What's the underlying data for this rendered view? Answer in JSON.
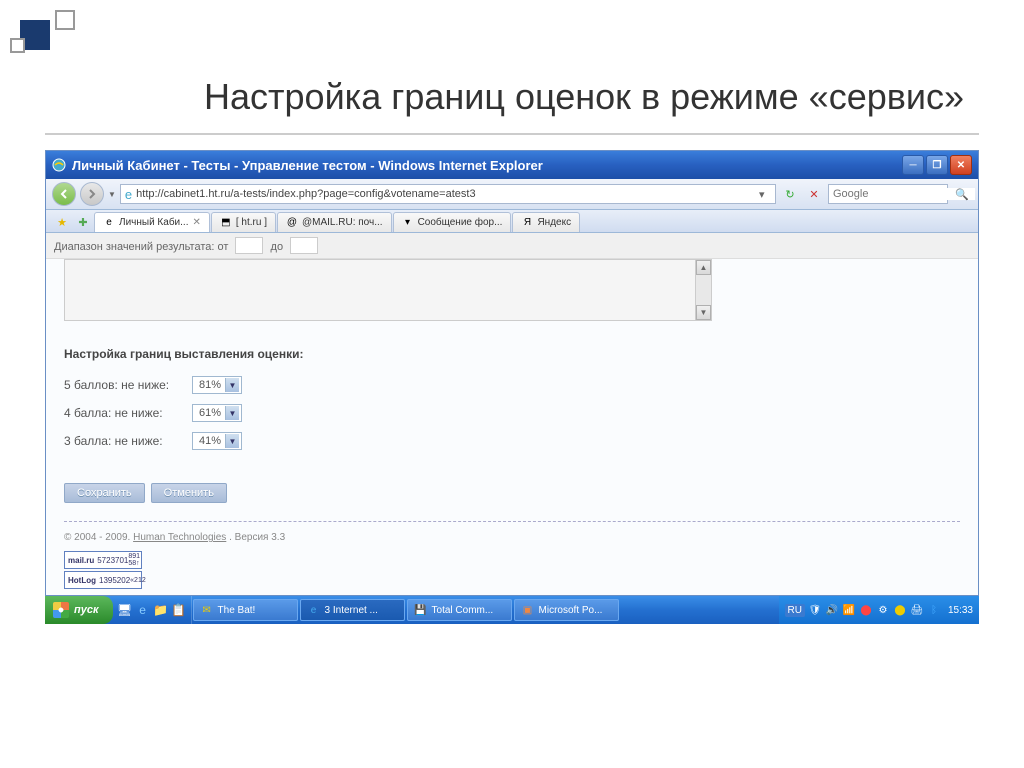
{
  "slide": {
    "title": "Настройка границ оценок в режиме «сервис»"
  },
  "window": {
    "title": "Личный Кабинет - Тесты - Управление тестом - Windows Internet Explorer",
    "url": "http://cabinet1.ht.ru/a-tests/index.php?page=config&votename=atest3",
    "search_placeholder": "Google"
  },
  "tabs": [
    {
      "label": "Личный Каби...",
      "icon": "e",
      "active": true
    },
    {
      "label": "[ ht.ru ]",
      "icon": "⬒"
    },
    {
      "label": "@MAIL.RU: поч...",
      "icon": "@"
    },
    {
      "label": "Сообщение фор...",
      "icon": "▾"
    },
    {
      "label": "Яндекс",
      "icon": "Я"
    }
  ],
  "page": {
    "range_label": "Диапазон значений результата: от",
    "range_to": "до",
    "section_title": "Настройка границ выставления оценки:",
    "grades": [
      {
        "label": "5 баллов: не ниже:",
        "value": "81%"
      },
      {
        "label": "4 балла: не ниже:",
        "value": "61%"
      },
      {
        "label": "3 балла: не ниже:",
        "value": "41%"
      }
    ],
    "save_btn": "Сохранить",
    "cancel_btn": "Отменить",
    "copyright": "© 2004 - 2009.",
    "copyright_link": "Human Technologies",
    "version": ". Версия 3.3",
    "counters": [
      {
        "name": "mail.ru",
        "num": "5723701",
        "side": "891\n58↑"
      },
      {
        "name": "HotLog",
        "num": "1395202",
        "side": "«212"
      }
    ]
  },
  "taskbar": {
    "start": "пуск",
    "items": [
      {
        "label": "The Bat!",
        "icon": "✉",
        "color": "#ec0"
      },
      {
        "label": "3 Internet ...",
        "icon": "e",
        "color": "#4ae",
        "active": true
      },
      {
        "label": "Total Comm...",
        "icon": "💾",
        "color": "#fff"
      },
      {
        "label": "Microsoft Po...",
        "icon": "▣",
        "color": "#e84"
      }
    ],
    "lang": "RU",
    "clock": "15:33"
  }
}
